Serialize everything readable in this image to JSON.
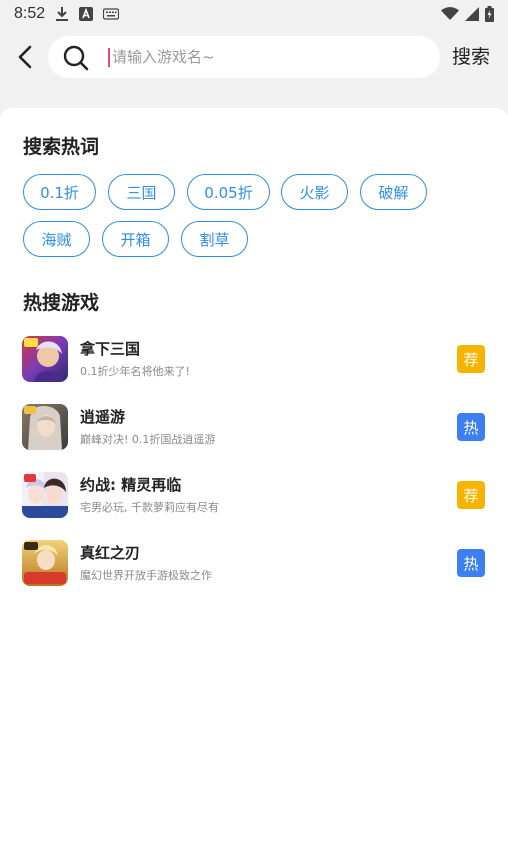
{
  "status_bar": {
    "time": "8:52",
    "left_icons": [
      "download-icon",
      "a-app-icon",
      "keyboard-icon"
    ],
    "right_icons": [
      "wifi-icon",
      "signal-icon",
      "battery-icon"
    ]
  },
  "search": {
    "placeholder": "请输入游戏名~",
    "value": "",
    "button_label": "搜索"
  },
  "hot_words": {
    "title": "搜索热词",
    "tags": [
      "0.1折",
      "三国",
      "0.05折",
      "火影",
      "破解",
      "海贼",
      "开箱",
      "割草"
    ]
  },
  "hot_games": {
    "title": "热搜游戏",
    "items": [
      {
        "name": "拿下三国",
        "desc": "0.1折少年名将他来了!",
        "badge": "荐",
        "badge_color": "#f5b400"
      },
      {
        "name": "逍遥游",
        "desc": "巅峰对决! 0.1折国战逍遥游",
        "badge": "热",
        "badge_color": "#3d7ff0"
      },
      {
        "name": "约战: 精灵再临",
        "desc": "宅男必玩, 千款萝莉应有尽有",
        "badge": "荐",
        "badge_color": "#f5b400"
      },
      {
        "name": "真红之刃",
        "desc": "魔幻世界开放手游极致之作",
        "badge": "热",
        "badge_color": "#3d7ff0"
      }
    ]
  },
  "colors": {
    "accent": "#2f8fe4",
    "tag_recommend": "#f5b400",
    "tag_hot": "#3d7ff0",
    "caret": "#e8477a"
  }
}
